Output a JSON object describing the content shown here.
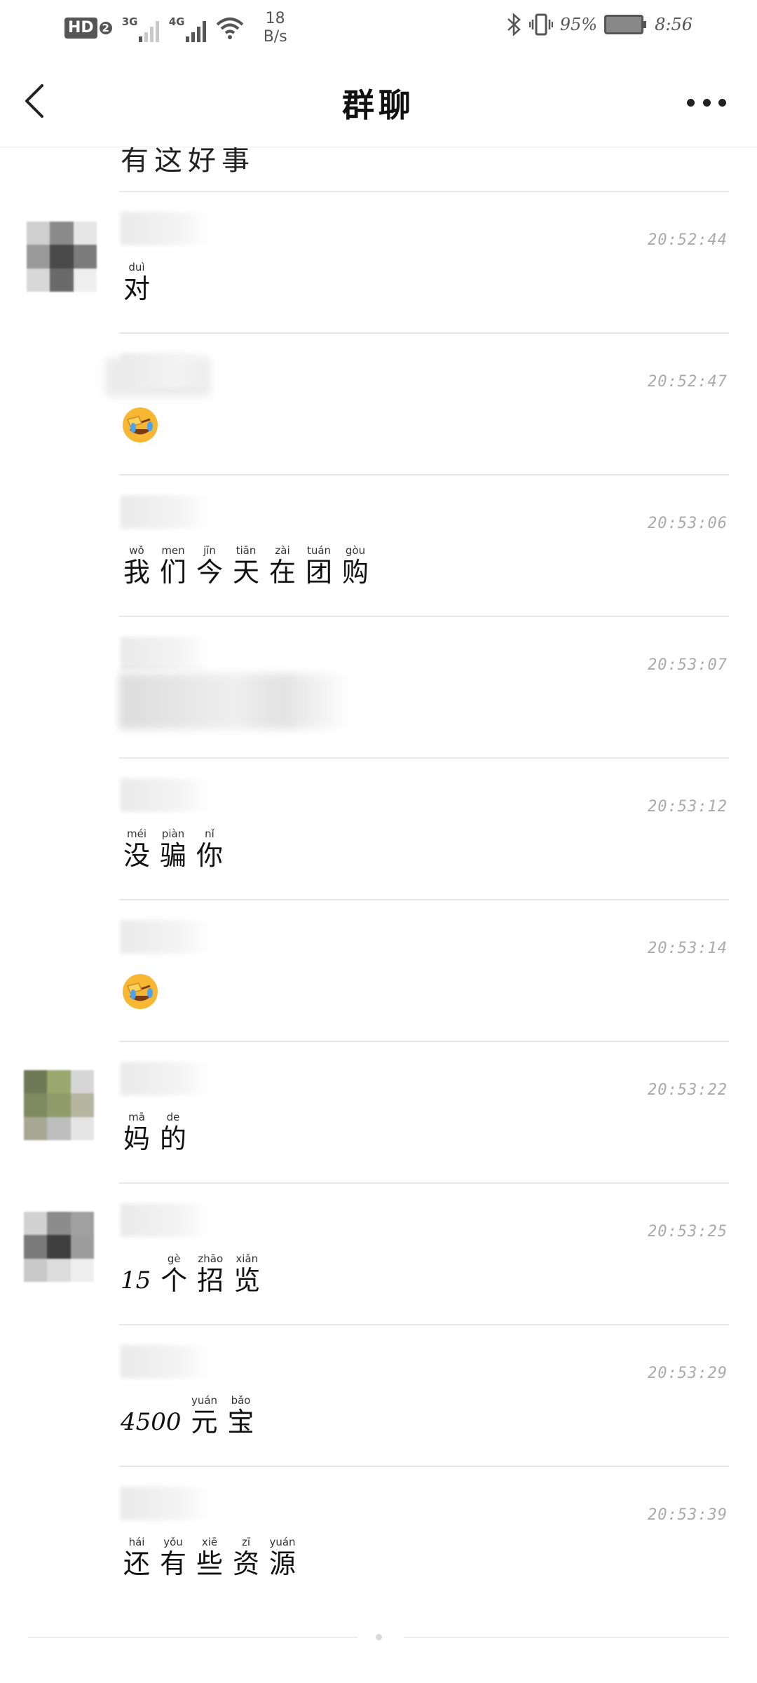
{
  "status_bar": {
    "hd": "HD",
    "hd_sim": "2",
    "net1": "3G",
    "net2": "4G",
    "speed_value": "18",
    "speed_unit": "B/s",
    "battery": "95%",
    "time": "8:56"
  },
  "header": {
    "title": "群聊"
  },
  "chat": {
    "partial_message": "有这好事",
    "messages": [
      {
        "time": "20:52:44",
        "type": "text",
        "chars": [
          {
            "h": "对",
            "p": "duì"
          }
        ]
      },
      {
        "time": "20:52:47",
        "type": "emoji",
        "emoji": "facepalm-cry-icon"
      },
      {
        "time": "20:53:06",
        "type": "text",
        "chars": [
          {
            "h": "我",
            "p": "wǒ"
          },
          {
            "h": "们",
            "p": "men"
          },
          {
            "h": "今",
            "p": "jīn"
          },
          {
            "h": "天",
            "p": "tiān"
          },
          {
            "h": "在",
            "p": "zài"
          },
          {
            "h": "团",
            "p": "tuán"
          },
          {
            "h": "购",
            "p": "gòu"
          }
        ]
      },
      {
        "time": "20:53:07",
        "type": "image"
      },
      {
        "time": "20:53:12",
        "type": "text",
        "chars": [
          {
            "h": "没",
            "p": "méi"
          },
          {
            "h": "骗",
            "p": "piàn"
          },
          {
            "h": "你",
            "p": "nǐ"
          }
        ]
      },
      {
        "time": "20:53:14",
        "type": "emoji",
        "emoji": "facepalm-cry-icon"
      },
      {
        "time": "20:53:22",
        "type": "text",
        "chars": [
          {
            "h": "妈",
            "p": "mā"
          },
          {
            "h": "的",
            "p": "de"
          }
        ]
      },
      {
        "time": "20:53:25",
        "type": "text",
        "prefix": "15",
        "chars": [
          {
            "h": "个",
            "p": "gè"
          },
          {
            "h": "招",
            "p": "zhāo"
          },
          {
            "h": "览",
            "p": "xiǎn"
          }
        ]
      },
      {
        "time": "20:53:29",
        "type": "text",
        "prefix": "4500",
        "chars": [
          {
            "h": "元",
            "p": "yuán"
          },
          {
            "h": "宝",
            "p": "bǎo"
          }
        ]
      },
      {
        "time": "20:53:39",
        "type": "text",
        "chars": [
          {
            "h": "还",
            "p": "hái"
          },
          {
            "h": "有",
            "p": "yǒu"
          },
          {
            "h": "些",
            "p": "xiē"
          },
          {
            "h": "资",
            "p": "zī"
          },
          {
            "h": "源",
            "p": "yuán"
          }
        ]
      }
    ]
  },
  "colors": {
    "separator": "#e8e8e8",
    "timestamp": "#aaaaaa",
    "emoji_face": "#f7b733"
  }
}
